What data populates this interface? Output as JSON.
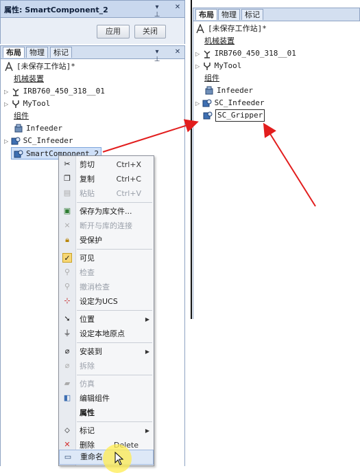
{
  "properties_panel": {
    "title": "属性: SmartComponent_2",
    "pin_glyph": "▾ ⊥",
    "close_glyph": "✕",
    "apply_label": "应用",
    "close_label": "关闭"
  },
  "left_tabs": [
    "布局",
    "物理",
    "标记"
  ],
  "right_tabs": [
    "布局",
    "物理",
    "标记"
  ],
  "tab_controls": {
    "pin": "▾ ⊥",
    "close": "✕"
  },
  "left_tree": {
    "station": "[未保存工作站]*",
    "mechanisms_group": "机械装置",
    "robot": "IRB760_450_318__01",
    "tool": "MyTool",
    "components_group": "组件",
    "infeeder": "Infeeder",
    "sc_infeeder": "SC_Infeeder",
    "smart_component": "SmartComponent_2"
  },
  "right_tree": {
    "station": "[未保存工作站]*",
    "mechanisms_group": "机械装置",
    "robot": "IRB760_450_318__01",
    "tool": "MyTool",
    "components_group": "组件",
    "infeeder": "Infeeder",
    "sc_infeeder": "SC_Infeeder",
    "rename_value": "SC_Gripper"
  },
  "context_menu": {
    "cut": "剪切",
    "cut_shortcut": "Ctrl+X",
    "copy": "复制",
    "copy_shortcut": "Ctrl+C",
    "paste": "粘贴",
    "paste_shortcut": "Ctrl+V",
    "save_as_library": "保存为库文件...",
    "disconnect_library": "断开与库的连接",
    "protected": "受保护",
    "visible": "可见",
    "check": "检查",
    "uncheck": "撤消检查",
    "set_ucs": "设定为UCS",
    "position": "位置",
    "set_local_origin": "设定本地原点",
    "install_to": "安装到",
    "remove": "拆除",
    "simulation": "仿真",
    "edit_component": "编辑组件",
    "properties": "属性",
    "mark": "标记",
    "delete": "删除",
    "delete_shortcut": "Delete",
    "rename": "重命名"
  },
  "colors": {
    "arrow": "#e21d1d",
    "selection": "#cfe0f8",
    "header": "#c9d8ee"
  }
}
